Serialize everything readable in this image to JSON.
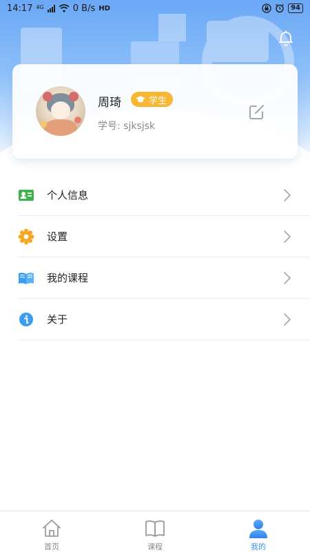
{
  "status_bar": {
    "time": "14:17",
    "network": "4G",
    "speed": "0 B/s",
    "hd": "HD",
    "battery": "94"
  },
  "colors": {
    "accent": "#3d8ff0",
    "badge": "#f7b733",
    "header": "#6aa7f5"
  },
  "header": {
    "bell_icon": "bell-icon"
  },
  "profile": {
    "name": "周琦",
    "role": "学生",
    "student_id": "学号: sjksjsk",
    "edit_icon": "edit-icon"
  },
  "menu": {
    "items": [
      {
        "label": "个人信息",
        "icon": "id-card-icon"
      },
      {
        "label": "设置",
        "icon": "gear-icon"
      },
      {
        "label": "我的课程",
        "icon": "book-icon"
      },
      {
        "label": "关于",
        "icon": "info-icon"
      }
    ]
  },
  "tabs": [
    {
      "label": "首页",
      "icon": "home-icon",
      "active": false
    },
    {
      "label": "课程",
      "icon": "book-outline-icon",
      "active": false
    },
    {
      "label": "我的",
      "icon": "user-icon",
      "active": true
    }
  ]
}
